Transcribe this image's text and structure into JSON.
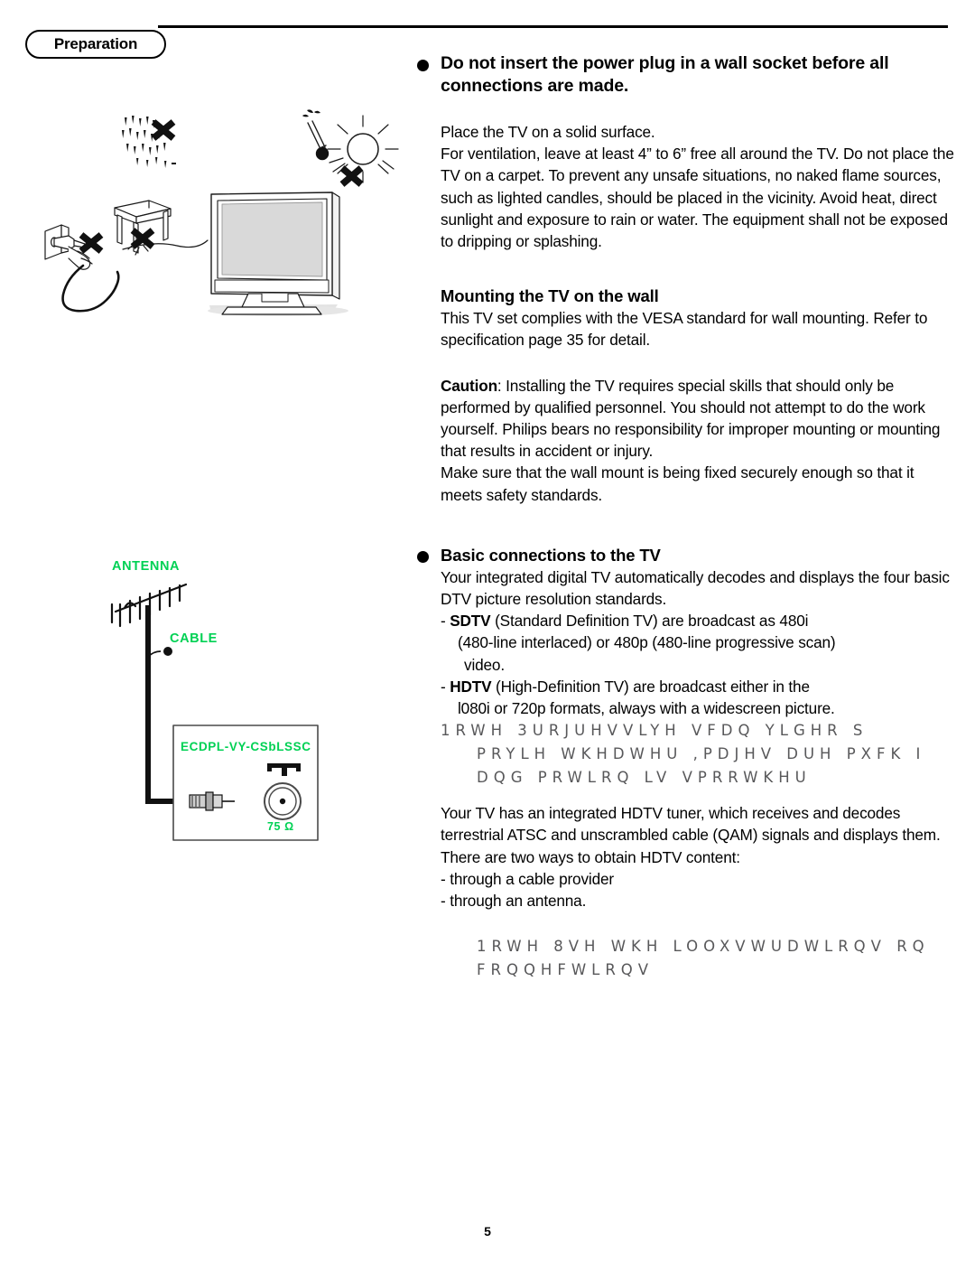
{
  "header": {
    "section_tab": "Preparation"
  },
  "main": {
    "warning_heading": "Do not insert the power plug in a wall socket before all connections are made.",
    "intro_lines": [
      "Place the TV on a solid surface.",
      "For ventilation, leave at least 4” to 6” free all around the TV. Do not place the TV on a carpet. To prevent any unsafe situations, no naked flame sources, such as lighted candles, should be placed in the vicinity. Avoid heat, direct sunlight and exposure to rain or water. The equipment shall not be exposed to dripping or splashing."
    ],
    "mounting": {
      "heading": "Mounting the TV on the wall",
      "body": "This TV set complies with the VESA standard for wall mounting. Refer to specification page 35 for detail.",
      "caution_label": "Caution",
      "caution_body": ": Installing the TV requires special skills that should only be performed by qualified personnel. You should not attempt to do the work yourself. Philips bears no responsibility for improper mounting or mounting that results in accident or injury.",
      "caution_body2": "Make sure that the wall mount is being fixed securely enough so that it meets safety standards."
    },
    "basic_connections": {
      "heading": "Basic connections to the TV",
      "intro": "Your integrated digital TV automatically decodes and displays the four basic DTV picture resolution standards.",
      "sdtv_label": "SDTV",
      "sdtv_text": " (Standard Definition TV) are broadcast as 480i",
      "sdtv_text2": "(480-line interlaced) or 480p (480-line progressive scan)",
      "sdtv_text3": "video.",
      "hdtv_label": "HDTV",
      "hdtv_text": " (High-Definition TV) are broadcast either in the",
      "hdtv_text2": "l080i or 720p formats, always with a widescreen picture.",
      "garbled_block_1": [
        "1RWH  3URJUHVVLYH VFDQ YLGHR  S",
        "PRYLH WKHDWHU ,PDJHV DUH PXFK I",
        "DQG PRWLRQ LV VPRRWKHU"
      ],
      "tuner_text": "Your TV has an integrated HDTV tuner, which receives and decodes terrestrial ATSC and unscrambled cable (QAM) signals and displays them. There are two ways to obtain HDTV content:",
      "tuner_bullets": [
        "- through a cable provider",
        "- through an antenna."
      ],
      "garbled_block_2": [
        "1RWH  8VH WKH LOOXVWUDWLRQV RQ",
        "FRQQHFWLRQV"
      ]
    }
  },
  "diagram": {
    "antenna_label": "ANTENNA",
    "cable_label": "CABLE",
    "panel_label": "ECDPL-VY-CSbLSSC",
    "impedance_label": "75 Ω",
    "green": "#00d154"
  },
  "footer": {
    "page_number": "5"
  }
}
